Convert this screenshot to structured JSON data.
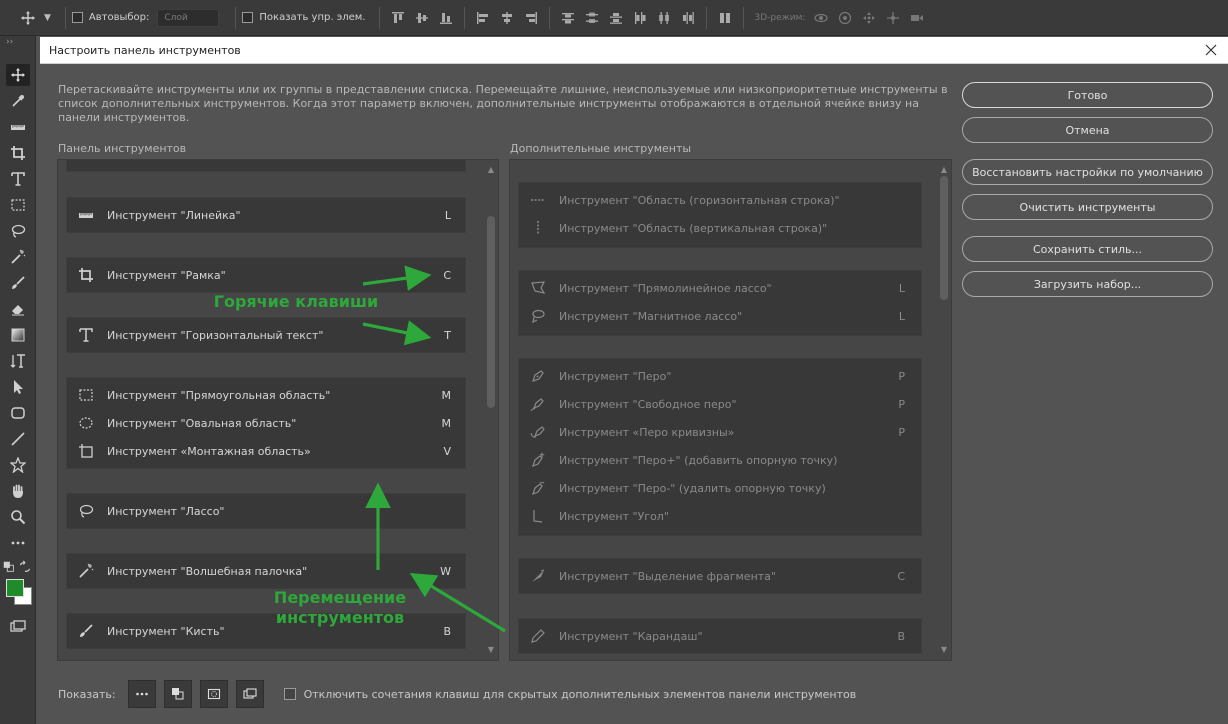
{
  "options_bar": {
    "autoselect_label": "Автовыбор:",
    "autoselect_value": "Слой",
    "show_controls_label": "Показать упр. элем.",
    "mode_3d_label": "3D-режим:"
  },
  "dialog": {
    "title": "Настроить панель инструментов",
    "description": "Перетаскивайте инструменты или их группы в представлении списка. Перемещайте лишние, неиспользуемые или низкоприоритетные инструменты в список дополнительных инструментов. Когда этот параметр включен, дополнительные инструменты отображаются в отдельной ячейке внизу на панели инструментов.",
    "toolbar_heading": "Панель инструментов",
    "extra_heading": "Дополнительные инструменты",
    "toolbar_groups": [
      {
        "items": [
          {
            "icon": "ruler-icon",
            "label": "Инструмент \"Линейка\"",
            "key": "L"
          }
        ]
      },
      {
        "items": [
          {
            "icon": "crop-icon",
            "label": "Инструмент \"Рамка\"",
            "key": "C"
          }
        ]
      },
      {
        "items": [
          {
            "icon": "type-icon",
            "label": "Инструмент \"Горизонтальный текст\"",
            "key": "T"
          }
        ]
      },
      {
        "items": [
          {
            "icon": "rect-marquee-icon",
            "label": "Инструмент \"Прямоугольная область\"",
            "key": "M"
          },
          {
            "icon": "ellipse-marquee-icon",
            "label": "Инструмент \"Овальная область\"",
            "key": "M"
          },
          {
            "icon": "artboard-icon",
            "label": "Инструмент «Монтажная область»",
            "key": "V"
          }
        ]
      },
      {
        "items": [
          {
            "icon": "lasso-icon",
            "label": "Инструмент \"Лассо\"",
            "key": ""
          }
        ]
      },
      {
        "items": [
          {
            "icon": "magic-wand-icon",
            "label": "Инструмент \"Волшебная палочка\"",
            "key": "W"
          }
        ]
      },
      {
        "items": [
          {
            "icon": "brush-icon",
            "label": "Инструмент \"Кисть\"",
            "key": "B"
          }
        ]
      }
    ],
    "extra_groups": [
      {
        "items": [
          {
            "icon": "single-row-marquee-icon",
            "label": "Инструмент \"Область (горизонтальная строка)\"",
            "key": ""
          },
          {
            "icon": "single-column-marquee-icon",
            "label": "Инструмент \"Область (вертикальная строка)\"",
            "key": ""
          }
        ]
      },
      {
        "items": [
          {
            "icon": "polygonal-lasso-icon",
            "label": "Инструмент \"Прямолинейное лассо\"",
            "key": "L"
          },
          {
            "icon": "magnetic-lasso-icon",
            "label": "Инструмент \"Магнитное лассо\"",
            "key": "L"
          }
        ]
      },
      {
        "items": [
          {
            "icon": "pen-icon",
            "label": "Инструмент \"Перо\"",
            "key": "P"
          },
          {
            "icon": "freeform-pen-icon",
            "label": "Инструмент \"Свободное перо\"",
            "key": "P"
          },
          {
            "icon": "curvature-pen-icon",
            "label": "Инструмент «Перо кривизны»",
            "key": "P"
          },
          {
            "icon": "add-anchor-icon",
            "label": "Инструмент \"Перо+\" (добавить опорную точку)",
            "key": ""
          },
          {
            "icon": "delete-anchor-icon",
            "label": "Инструмент \"Перо-\" (удалить опорную точку)",
            "key": ""
          },
          {
            "icon": "convert-point-icon",
            "label": "Инструмент \"Угол\"",
            "key": ""
          }
        ]
      },
      {
        "items": [
          {
            "icon": "slice-select-icon",
            "label": "Инструмент \"Выделение фрагмента\"",
            "key": "C"
          }
        ]
      },
      {
        "items": [
          {
            "icon": "pencil-icon",
            "label": "Инструмент \"Карандаш\"",
            "key": "B"
          }
        ]
      }
    ],
    "buttons": {
      "done": "Готово",
      "cancel": "Отмена",
      "restore_defaults": "Восстановить настройки по умолчанию",
      "clear_tools": "Очистить инструменты",
      "save_preset": "Сохранить стиль...",
      "load_preset": "Загрузить набор..."
    },
    "bottom": {
      "show_label": "Показать:",
      "disable_shortcuts_label": "Отключить сочетания клавиш для скрытых дополнительных элементов панели инструментов"
    }
  },
  "annotations": {
    "hotkeys": "Горячие клавиши",
    "move_tools_line1": "Перемещение",
    "move_tools_line2": "инструментов",
    "accent_color": "#2ea83a"
  }
}
